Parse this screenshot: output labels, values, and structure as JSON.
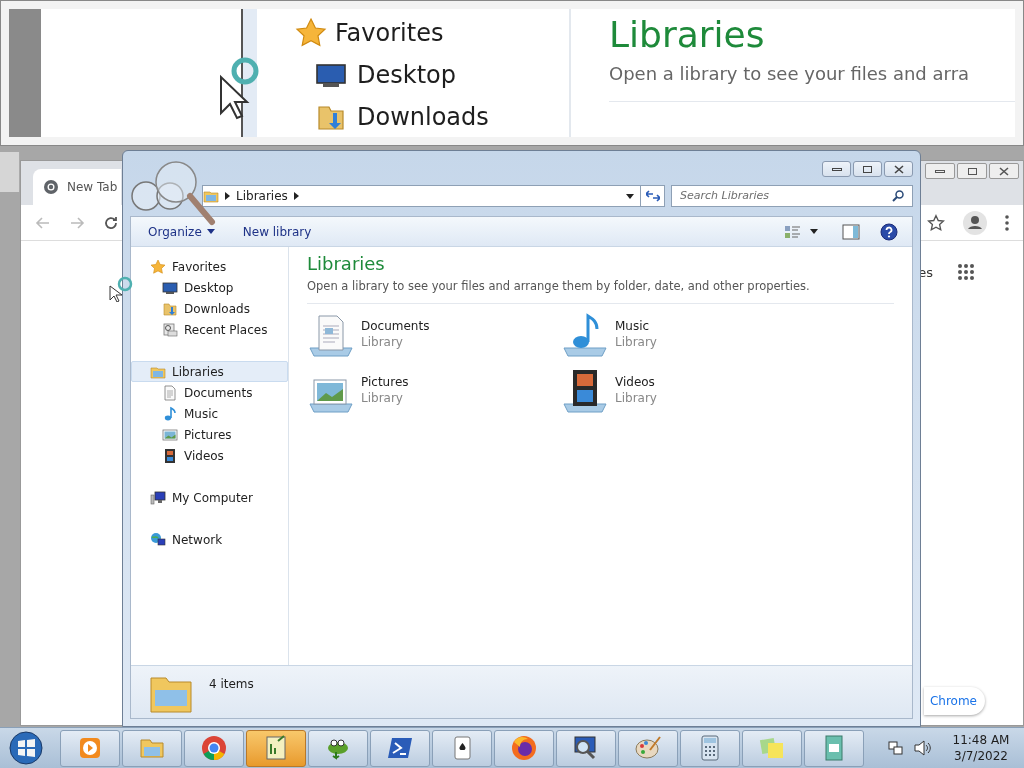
{
  "magnifier": {
    "group": "Favorites",
    "items": [
      "Desktop",
      "Downloads"
    ],
    "heading": "Libraries",
    "description": "Open a library to see your files and arra"
  },
  "browser": {
    "tab": "New Tab",
    "partial_link": "es",
    "button": "Chrome"
  },
  "explorer": {
    "breadcrumb": [
      "Libraries"
    ],
    "search_placeholder": "Search Libraries",
    "toolbar": [
      "Organize",
      "New library"
    ],
    "nav": [
      {
        "label": "Favorites",
        "kind": "star",
        "selected": false,
        "children": [
          {
            "label": "Desktop",
            "kind": "desktop",
            "selected": false
          },
          {
            "label": "Downloads",
            "kind": "downloads",
            "selected": false
          },
          {
            "label": "Recent Places",
            "kind": "recent",
            "selected": false
          }
        ]
      },
      {
        "label": "Libraries",
        "kind": "library",
        "selected": true,
        "children": [
          {
            "label": "Documents",
            "kind": "documents",
            "selected": false
          },
          {
            "label": "Music",
            "kind": "music",
            "selected": false
          },
          {
            "label": "Pictures",
            "kind": "pictures",
            "selected": false
          },
          {
            "label": "Videos",
            "kind": "videos",
            "selected": false
          }
        ]
      },
      {
        "label": "My Computer",
        "kind": "computer",
        "selected": false
      },
      {
        "label": "Network",
        "kind": "network",
        "selected": false
      }
    ],
    "heading": "Libraries",
    "description": "Open a library to see your files and arrange them by folder, date, and other properties.",
    "libraries": [
      {
        "name": "Documents",
        "type": "Library",
        "kind": "documents"
      },
      {
        "name": "Music",
        "type": "Library",
        "kind": "music"
      },
      {
        "name": "Pictures",
        "type": "Library",
        "kind": "pictures"
      },
      {
        "name": "Videos",
        "type": "Library",
        "kind": "videos"
      }
    ],
    "status": "4 items"
  },
  "taskbar": {
    "apps": [
      {
        "kind": "media",
        "selected": false
      },
      {
        "kind": "folder",
        "selected": false
      },
      {
        "kind": "chrome",
        "selected": false
      },
      {
        "kind": "notepad",
        "selected": true
      },
      {
        "kind": "lizard",
        "selected": false
      },
      {
        "kind": "terminal",
        "selected": false
      },
      {
        "kind": "cards",
        "selected": false
      },
      {
        "kind": "fox",
        "selected": false
      },
      {
        "kind": "magnifier",
        "selected": false
      },
      {
        "kind": "paint",
        "selected": false
      },
      {
        "kind": "calculator",
        "selected": false
      },
      {
        "kind": "notes",
        "selected": false
      },
      {
        "kind": "document",
        "selected": false
      }
    ],
    "time": "11:48 AM",
    "date": "3/7/2022"
  }
}
